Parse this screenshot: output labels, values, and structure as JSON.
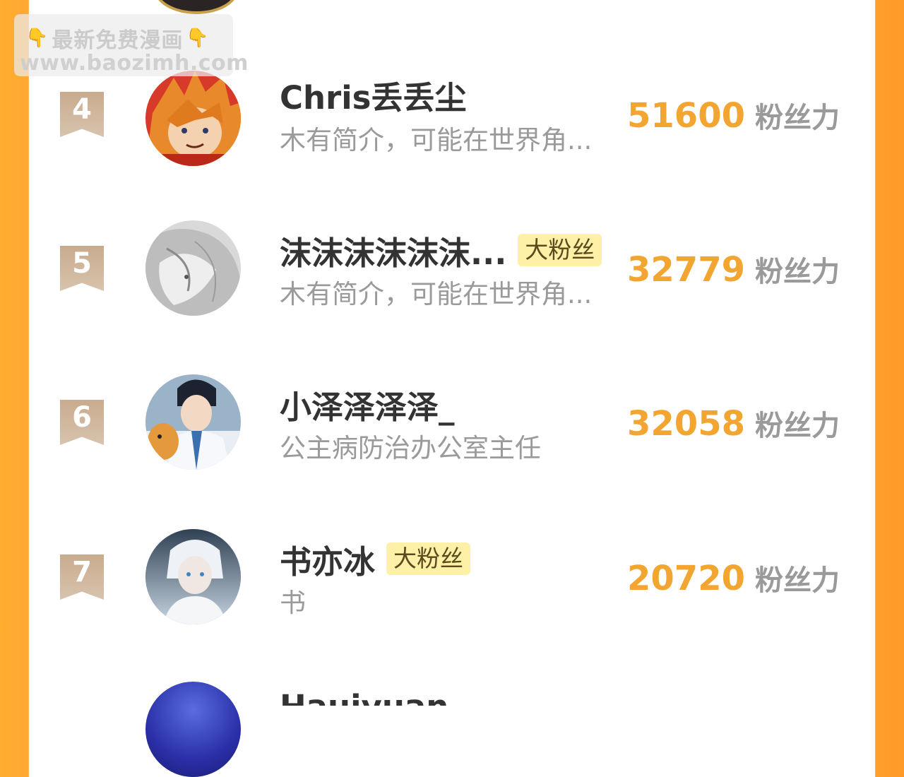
{
  "watermark": {
    "line1": "最新免费漫画",
    "line2": "www.baozimh.com"
  },
  "fans_unit": "粉丝力",
  "tag_label": "大粉丝",
  "rows": [
    {
      "rank": "4",
      "name": "Chris丢丢尘",
      "bio": "木有简介，可能在世界角...",
      "fans": "51600",
      "tag": ""
    },
    {
      "rank": "5",
      "name": "沫沫沫沫沫沫...",
      "bio": "木有简介，可能在世界角...",
      "fans": "32779",
      "tag": "大粉丝"
    },
    {
      "rank": "6",
      "name": "小泽泽泽泽_",
      "bio": "公主病防治办公室主任",
      "fans": "32058",
      "tag": ""
    },
    {
      "rank": "7",
      "name": "书亦冰",
      "bio": "书",
      "fans": "20720",
      "tag": "大粉丝"
    }
  ],
  "next_row": {
    "name": "Hauiyuan"
  }
}
